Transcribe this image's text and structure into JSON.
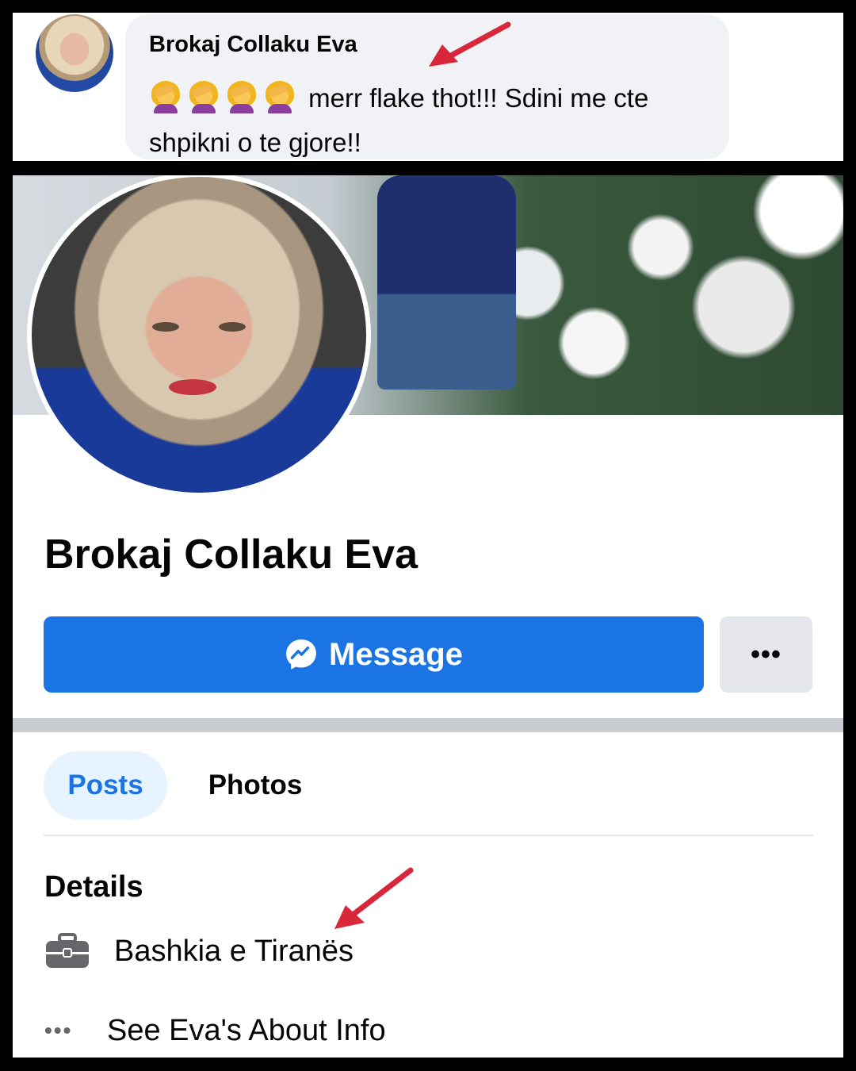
{
  "comment": {
    "author": "Brokaj Collaku Eva",
    "emoji_count": 4,
    "emoji_icon": "woman-facepalming-emoji",
    "text": "merr flake thot!!! Sdini me cte shpikni o te gjore!!"
  },
  "profile": {
    "name": "Brokaj Collaku Eva",
    "message_button_label": "Message",
    "more_button_label": "•••",
    "tabs": [
      {
        "label": "Posts",
        "active": true
      },
      {
        "label": "Photos",
        "active": false
      }
    ],
    "details_heading": "Details",
    "work": "Bashkia e Tiranës",
    "about_link": "See Eva's About Info",
    "about_dots": "•••"
  },
  "colors": {
    "accent_blue": "#1b74e4",
    "active_tab_bg": "#e7f3ff",
    "annotation_red": "#d8263a"
  }
}
